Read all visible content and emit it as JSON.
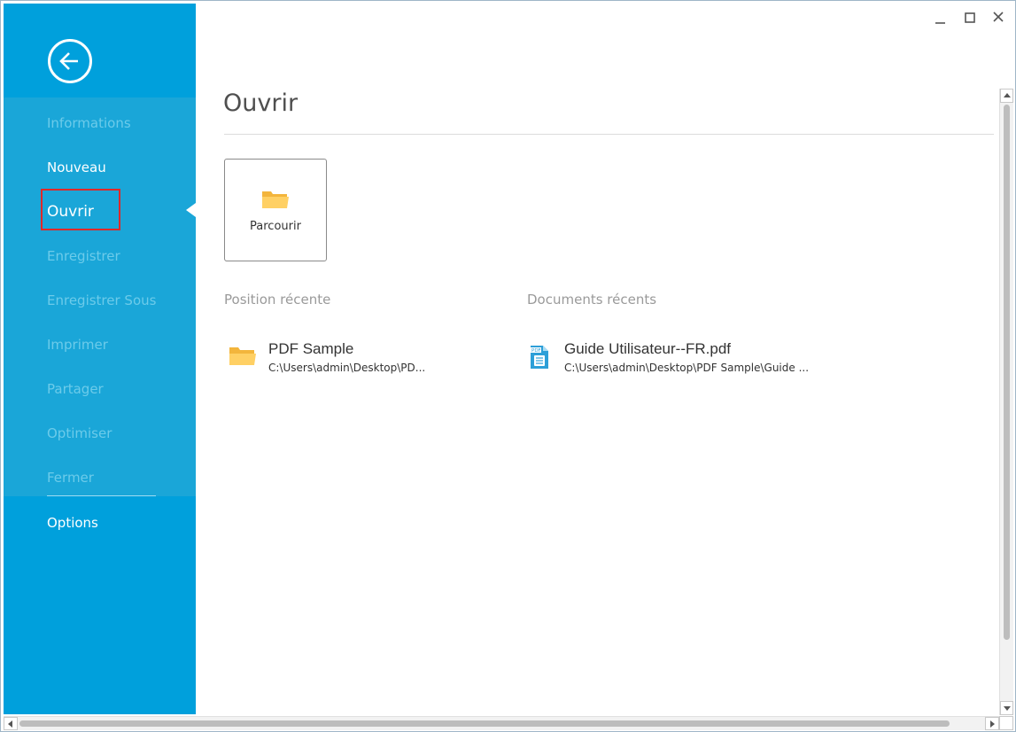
{
  "window": {
    "controls": {
      "minimize_icon": "minimize-icon",
      "maximize_icon": "maximize-icon",
      "close_icon": "close-icon"
    }
  },
  "sidebar": {
    "back_icon": "back-arrow-icon",
    "items": [
      {
        "label": "Informations",
        "state": "disabled"
      },
      {
        "label": "Nouveau",
        "state": "enabled"
      },
      {
        "label": "Ouvrir",
        "state": "active"
      },
      {
        "label": "Enregistrer",
        "state": "disabled"
      },
      {
        "label": "Enregistrer Sous",
        "state": "disabled"
      },
      {
        "label": "Imprimer",
        "state": "disabled"
      },
      {
        "label": "Partager",
        "state": "disabled"
      },
      {
        "label": "Optimiser",
        "state": "disabled"
      },
      {
        "label": "Fermer",
        "state": "disabled"
      }
    ],
    "options_label": "Options",
    "colors": {
      "background": "#1aa6d8",
      "active_box": "#e02828",
      "disabled_text": "#6ccbea"
    }
  },
  "main": {
    "title": "Ouvrir",
    "browse": {
      "label": "Parcourir",
      "icon": "folder-icon"
    },
    "recent_locations": {
      "heading": "Position récente",
      "items": [
        {
          "name": "PDF Sample",
          "path": "C:\\Users\\admin\\Desktop\\PD...",
          "icon": "folder-icon"
        }
      ]
    },
    "recent_documents": {
      "heading": "Documents récents",
      "items": [
        {
          "name": "Guide Utilisateur--FR.pdf",
          "path": "C:\\Users\\admin\\Desktop\\PDF Sample\\Guide ...",
          "icon": "pdf-file-icon"
        }
      ]
    }
  }
}
